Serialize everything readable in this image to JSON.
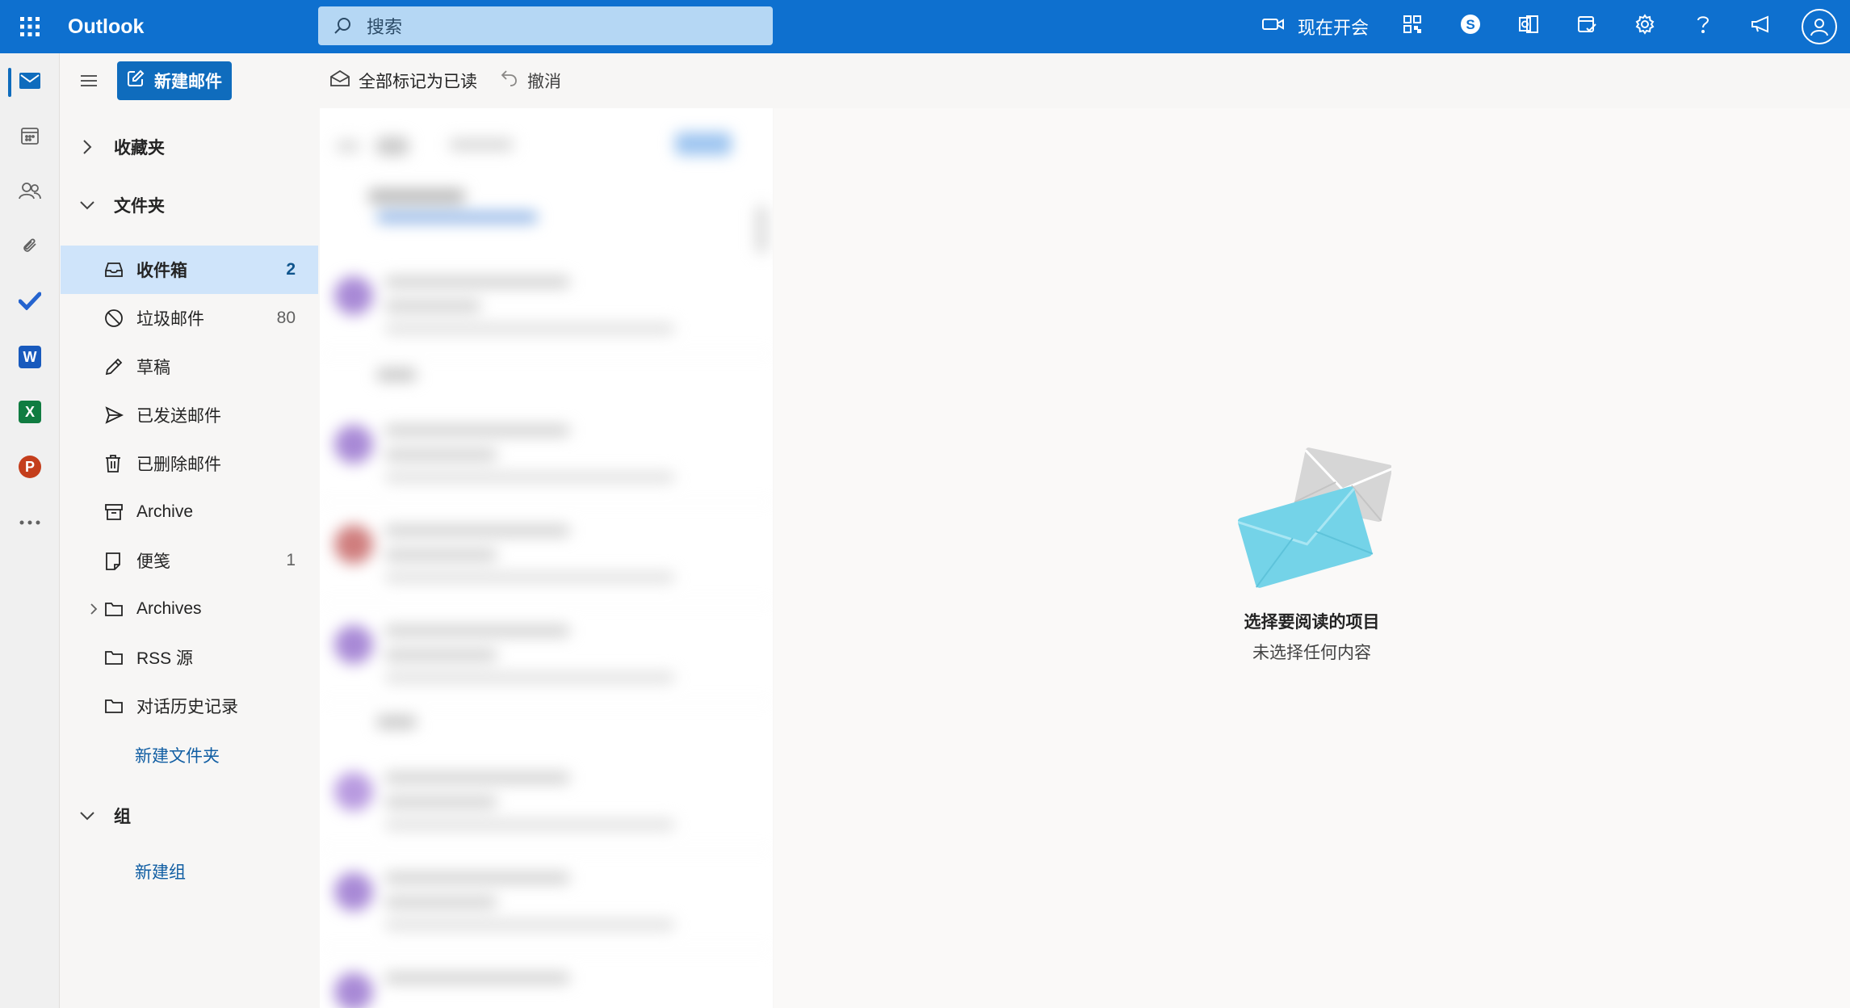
{
  "app": {
    "name": "Outlook",
    "accent_color": "#0f6cbd"
  },
  "search": {
    "placeholder": "搜索"
  },
  "topbar": {
    "meet_now_label": "现在开会",
    "icons": [
      "video-camera-icon",
      "qr-code-icon",
      "skype-icon",
      "outlook-app-icon",
      "whats-new-icon",
      "settings-gear-icon",
      "help-icon",
      "feedback-megaphone-icon",
      "account-avatar-icon"
    ]
  },
  "rail": {
    "items": [
      "mail-icon",
      "calendar-icon",
      "people-icon",
      "attachment-icon",
      "todo-check-icon",
      "word-icon",
      "excel-icon",
      "powerpoint-icon",
      "more-apps-icon"
    ],
    "word_letter": "W",
    "excel_letter": "X",
    "powerpoint_letter": "P"
  },
  "folder_pane": {
    "new_mail_label": "新建邮件",
    "favorites_label": "收藏夹",
    "folders_label": "文件夹",
    "folders": [
      {
        "name": "收件箱",
        "count": "2",
        "icon": "inbox-icon",
        "selected": true
      },
      {
        "name": "垃圾邮件",
        "count": "80",
        "icon": "junk-icon"
      },
      {
        "name": "草稿",
        "count": "",
        "icon": "draft-pencil-icon"
      },
      {
        "name": "已发送邮件",
        "count": "",
        "icon": "sent-icon"
      },
      {
        "name": "已删除邮件",
        "count": "",
        "icon": "trash-icon"
      },
      {
        "name": "Archive",
        "count": "",
        "icon": "archive-icon"
      },
      {
        "name": "便笺",
        "count": "1",
        "icon": "notes-icon"
      },
      {
        "name": "Archives",
        "count": "",
        "icon": "folder-icon",
        "expandable": true
      },
      {
        "name": "RSS 源",
        "count": "",
        "icon": "folder-icon"
      },
      {
        "name": "对话历史记录",
        "count": "",
        "icon": "folder-icon"
      }
    ],
    "new_folder_label": "新建文件夹",
    "groups_label": "组",
    "new_group_label": "新建组"
  },
  "toolbar": {
    "mark_all_read_label": "全部标记为已读",
    "undo_label": "撤消"
  },
  "reading_pane": {
    "empty_title": "选择要阅读的项目",
    "empty_subtitle": "未选择任何内容"
  }
}
